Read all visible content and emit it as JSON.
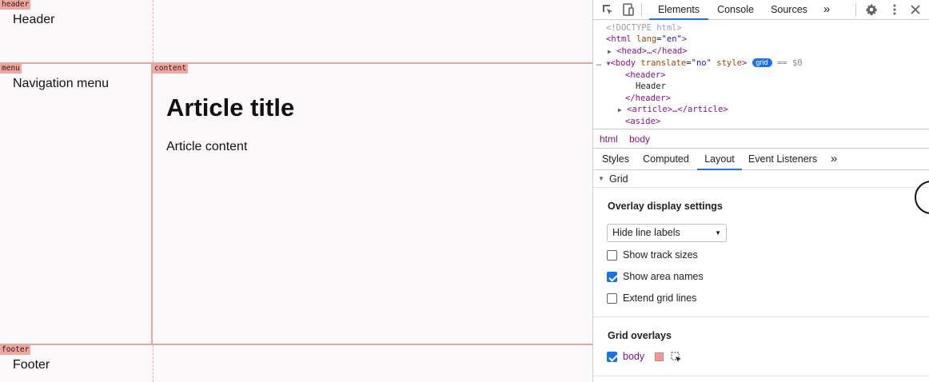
{
  "preview": {
    "area_labels": {
      "header": "header",
      "menu": "menu",
      "content": "content",
      "footer": "footer"
    },
    "header_text": "Header",
    "menu_text": "Navigation menu",
    "article_title": "Article title",
    "article_content": "Article content",
    "footer_text": "Footer",
    "grid_color": "#e8a3a3"
  },
  "devtools": {
    "tabs": [
      "Elements",
      "Console",
      "Sources"
    ],
    "active_tab": "Elements",
    "more_tabs": "»",
    "dom": {
      "doctype": "<!DOCTYPE html>",
      "html_open_tag": "<html",
      "html_attr": "lang",
      "html_attr_val": "\"en\"",
      "html_close_bracket": ">",
      "head_line": "<head>…</head>",
      "body_ellipsis": "…",
      "body_open_tag": "<body",
      "body_attr1": "translate",
      "body_attr1_val": "\"no\"",
      "body_attr2": "style",
      "body_close_bracket": ">",
      "grid_badge": "grid",
      "selected_marker": "== $0",
      "header_open": "<header>",
      "header_text": "Header",
      "header_close": "</header>",
      "article_line": "<article>…</article>",
      "aside_open": "<aside>"
    },
    "breadcrumbs": [
      "html",
      "body"
    ],
    "subtabs": [
      "Styles",
      "Computed",
      "Layout",
      "Event Listeners"
    ],
    "active_subtab": "Layout",
    "subtabs_more": "»",
    "grid_section": {
      "title": "Grid",
      "overlay_display_settings": "Overlay display settings",
      "line_labels_select": "Hide line labels",
      "options": [
        {
          "label": "Show track sizes",
          "checked": false
        },
        {
          "label": "Show area names",
          "checked": true
        },
        {
          "label": "Extend grid lines",
          "checked": false
        }
      ],
      "grid_overlays_title": "Grid overlays",
      "overlays": [
        {
          "label": "body",
          "checked": true,
          "color": "#ef9a9a"
        }
      ]
    },
    "accent_color": "#1a73e8"
  }
}
